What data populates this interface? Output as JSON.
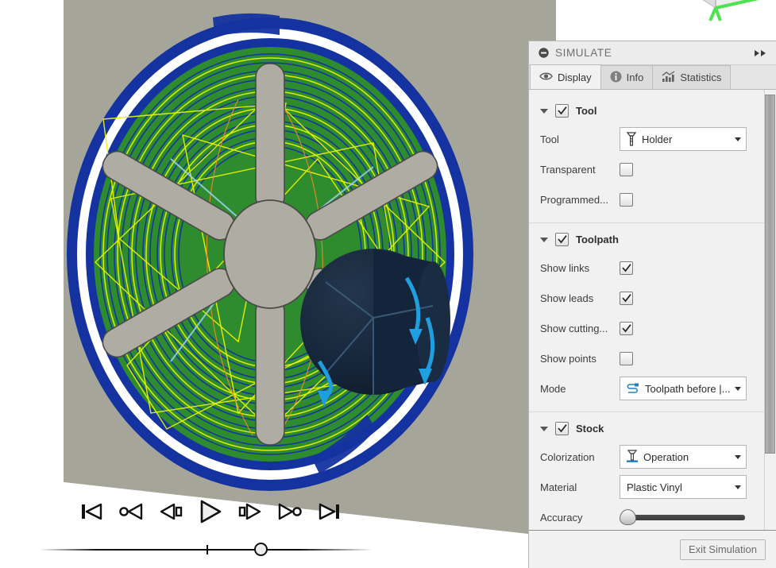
{
  "viewport": {
    "name": "cam-simulation-viewport",
    "stock_color": "#a6a59a",
    "machined_color": "#2e8b2e",
    "stock_edge_color": "#1433a0",
    "toolpath_cut_color": "#e8f500",
    "toolpath_link_color": "#1433a0",
    "lead_color": "#ef8a28",
    "tool_color": "#1b2a3c",
    "arrow_color": "#1f9fe0",
    "viewcube": {
      "label": "view-cube",
      "axis_y_color": "#4ce34c",
      "axis_z_color": "#7b6cf0"
    }
  },
  "playback": {
    "buttons": [
      {
        "name": "skip-to-start-button",
        "label": "Skip to Start",
        "icon": "skip-start-icon"
      },
      {
        "name": "previous-operation-button",
        "label": "Previous Operation",
        "icon": "prev-operation-icon"
      },
      {
        "name": "step-backward-button",
        "label": "Step Backward",
        "icon": "step-backward-icon"
      },
      {
        "name": "play-button",
        "label": "Play",
        "icon": "play-icon"
      },
      {
        "name": "step-forward-button",
        "label": "Step Forward",
        "icon": "step-forward-icon"
      },
      {
        "name": "next-operation-button",
        "label": "Next Operation",
        "icon": "next-operation-icon"
      },
      {
        "name": "skip-to-end-button",
        "label": "Skip to End",
        "icon": "skip-end-icon"
      }
    ],
    "timeline": {
      "name": "simulation-timeline",
      "handle_position_percent": 65,
      "tick_position_percent": 50
    }
  },
  "panel": {
    "title": "SIMULATE",
    "collapse_icon": "minus-circle-icon",
    "expand_icon": "double-chevron-right-icon",
    "tabs": [
      {
        "label": "Display",
        "icon": "eye-icon",
        "active": true
      },
      {
        "label": "Info",
        "icon": "info-icon",
        "active": false
      },
      {
        "label": "Statistics",
        "icon": "bar-chart-icon",
        "active": false
      }
    ],
    "groups": [
      {
        "title": "Tool",
        "checked": true,
        "rows": [
          {
            "type": "dropdown",
            "label": "Tool",
            "value": "Holder",
            "icon": "tool-holder-icon"
          },
          {
            "type": "checkbox",
            "label": "Transparent",
            "checked": false
          },
          {
            "type": "checkbox",
            "label": "Programmed...",
            "checked": false
          }
        ]
      },
      {
        "title": "Toolpath",
        "checked": true,
        "rows": [
          {
            "type": "checkbox",
            "label": "Show links",
            "checked": true
          },
          {
            "type": "checkbox",
            "label": "Show leads",
            "checked": true
          },
          {
            "type": "checkbox",
            "label": "Show cutting...",
            "checked": true
          },
          {
            "type": "checkbox",
            "label": "Show points",
            "checked": false
          },
          {
            "type": "dropdown",
            "label": "Mode",
            "value": "Toolpath before |...",
            "icon": "toolpath-mode-icon"
          }
        ]
      },
      {
        "title": "Stock",
        "checked": true,
        "rows": [
          {
            "type": "dropdown",
            "label": "Colorization",
            "value": "Operation",
            "icon": "colorization-icon"
          },
          {
            "type": "dropdown",
            "label": "Material",
            "value": "Plastic Vinyl",
            "icon": null
          },
          {
            "type": "slider",
            "label": "Accuracy",
            "value": 0
          }
        ]
      }
    ],
    "footer": {
      "exit_label": "Exit Simulation"
    },
    "scrollbar": {
      "name": "panel-scrollbar"
    }
  }
}
